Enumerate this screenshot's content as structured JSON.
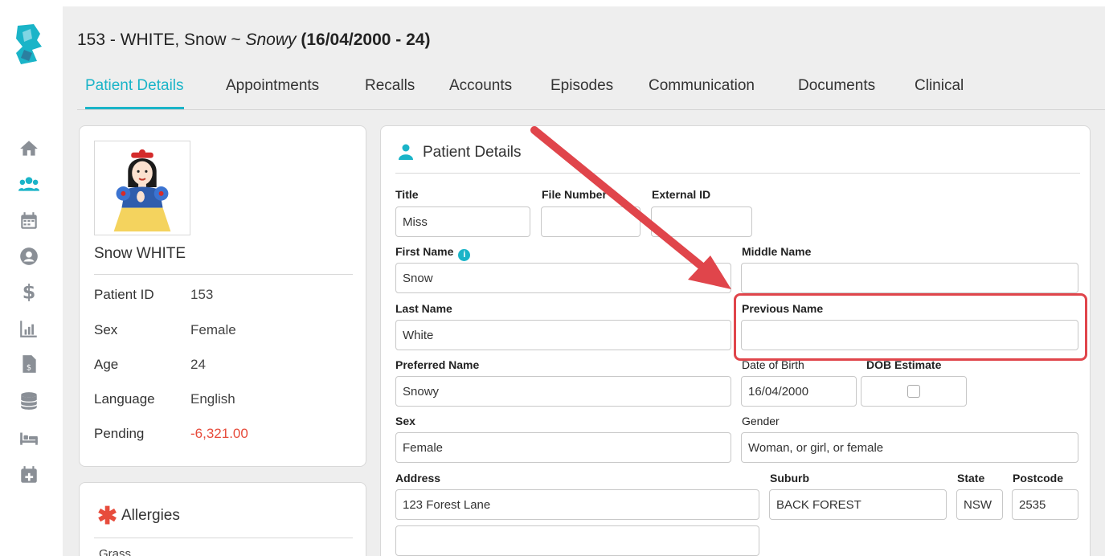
{
  "header": {
    "patient_prefix": "153 - WHITE, Snow ~ ",
    "nickname": "Snowy",
    "dob_age": "(16/04/2000 - 24)"
  },
  "tabs": [
    {
      "label": "Patient Details",
      "active": true
    },
    {
      "label": "Appointments",
      "active": false
    },
    {
      "label": "Recalls",
      "active": false
    },
    {
      "label": "Accounts",
      "active": false
    },
    {
      "label": "Episodes",
      "active": false
    },
    {
      "label": "Communication",
      "active": false
    },
    {
      "label": "Documents",
      "active": false
    },
    {
      "label": "Clinical",
      "active": false
    }
  ],
  "sidebar": {
    "icons": [
      "home-icon",
      "patients-icon",
      "calendar-icon",
      "user-circle-icon",
      "dollar-icon",
      "chart-icon",
      "invoice-icon",
      "database-icon",
      "bed-icon",
      "calendar-plus-icon"
    ],
    "active": "patients-icon",
    "accent_color": "#1ab4c8"
  },
  "summary": {
    "name": "Snow WHITE",
    "rows": [
      {
        "label": "Patient ID",
        "value": "153"
      },
      {
        "label": "Sex",
        "value": "Female"
      },
      {
        "label": "Age",
        "value": "24"
      },
      {
        "label": "Language",
        "value": "English"
      },
      {
        "label": "Pending",
        "value": "-6,321.00"
      }
    ],
    "pending_color": "#e74c3c"
  },
  "allergies": {
    "title": "Allergies",
    "items": [
      "Grass"
    ]
  },
  "details": {
    "title": "Patient Details",
    "fields": {
      "title": {
        "label": "Title",
        "value": "Miss"
      },
      "file_number": {
        "label": "File Number",
        "value": ""
      },
      "external_id": {
        "label": "External ID",
        "value": ""
      },
      "first_name": {
        "label": "First Name",
        "value": "Snow"
      },
      "middle_name": {
        "label": "Middle Name",
        "value": ""
      },
      "last_name": {
        "label": "Last Name",
        "value": "White"
      },
      "previous_name": {
        "label": "Previous Name",
        "value": ""
      },
      "preferred_name": {
        "label": "Preferred Name",
        "value": "Snowy"
      },
      "date_of_birth": {
        "label": "Date of Birth",
        "value": "16/04/2000"
      },
      "dob_estimate": {
        "label": "DOB Estimate",
        "checked": false
      },
      "sex": {
        "label": "Sex",
        "value": "Female"
      },
      "gender": {
        "label": "Gender",
        "value": "Woman, or girl, or female"
      },
      "address": {
        "label": "Address",
        "value": "123 Forest Lane",
        "line2": ""
      },
      "suburb": {
        "label": "Suburb",
        "value": "BACK FOREST"
      },
      "state": {
        "label": "State",
        "value": "NSW"
      },
      "postcode": {
        "label": "Postcode",
        "value": "2535"
      }
    }
  },
  "annotation": {
    "color": "#e0454b",
    "highlighted_field": "previous_name"
  }
}
